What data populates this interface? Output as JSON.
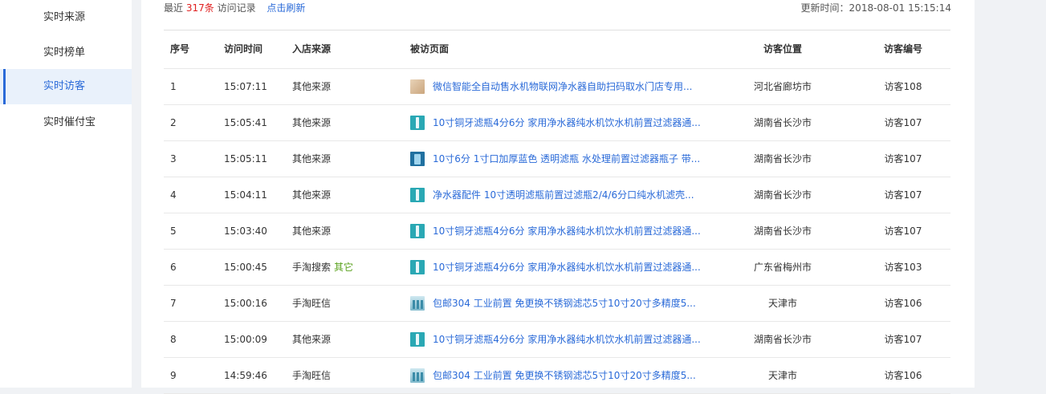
{
  "sidebar": {
    "items": [
      {
        "label": "实时来源",
        "active": false
      },
      {
        "label": "实时榜单",
        "active": false
      },
      {
        "label": "实时访客",
        "active": true
      },
      {
        "label": "实时催付宝",
        "active": false
      }
    ]
  },
  "summary": {
    "prefix": "最近",
    "count": "317条",
    "suffix": "访问记录",
    "refresh_label": "点击刷新",
    "updated_label": "更新时间：2018-08-01 15:15:14"
  },
  "table": {
    "headers": {
      "idx": "序号",
      "time": "访问时间",
      "source": "入店来源",
      "page": "被访页面",
      "location": "访客位置",
      "visitor": "访客编号"
    },
    "rows": [
      {
        "idx": "1",
        "time": "15:07:11",
        "source": "其他来源",
        "source_tag": "",
        "thumb": "product-thumb-tan",
        "page": "微信智能全自动售水机物联网净水器自助扫码取水门店专用...",
        "location": "河北省廊坊市",
        "visitor": "访客108"
      },
      {
        "idx": "2",
        "time": "15:05:41",
        "source": "其他来源",
        "source_tag": "",
        "thumb": "product-thumb-teal",
        "page": "10寸铜牙滤瓶4分6分 家用净水器纯水机饮水机前置过滤器通...",
        "location": "湖南省长沙市",
        "visitor": "访客107"
      },
      {
        "idx": "3",
        "time": "15:05:11",
        "source": "其他来源",
        "source_tag": "",
        "thumb": "product-thumb-blue",
        "page": "10寸6分 1寸口加厚蓝色 透明滤瓶 水处理前置过滤器瓶子 带...",
        "location": "湖南省长沙市",
        "visitor": "访客107"
      },
      {
        "idx": "4",
        "time": "15:04:11",
        "source": "其他来源",
        "source_tag": "",
        "thumb": "product-thumb-teal",
        "page": "净水器配件 10寸透明滤瓶前置过滤瓶2/4/6分口纯水机滤壳...",
        "location": "湖南省长沙市",
        "visitor": "访客107"
      },
      {
        "idx": "5",
        "time": "15:03:40",
        "source": "其他来源",
        "source_tag": "",
        "thumb": "product-thumb-teal",
        "page": "10寸铜牙滤瓶4分6分 家用净水器纯水机饮水机前置过滤器通...",
        "location": "湖南省长沙市",
        "visitor": "访客107"
      },
      {
        "idx": "6",
        "time": "15:00:45",
        "source": "手淘搜索",
        "source_tag": "其它",
        "thumb": "product-thumb-teal",
        "page": "10寸铜牙滤瓶4分6分 家用净水器纯水机饮水机前置过滤器通...",
        "location": "广东省梅州市",
        "visitor": "访客103"
      },
      {
        "idx": "7",
        "time": "15:00:16",
        "source": "手淘旺信",
        "source_tag": "",
        "thumb": "product-thumb-filters",
        "page": "包邮304 工业前置 免更换不锈钢滤芯5寸10寸20寸多精度5...",
        "location": "天津市",
        "visitor": "访客106"
      },
      {
        "idx": "8",
        "time": "15:00:09",
        "source": "其他来源",
        "source_tag": "",
        "thumb": "product-thumb-teal",
        "page": "10寸铜牙滤瓶4分6分 家用净水器纯水机饮水机前置过滤器通...",
        "location": "湖南省长沙市",
        "visitor": "访客107"
      },
      {
        "idx": "9",
        "time": "14:59:46",
        "source": "手淘旺信",
        "source_tag": "",
        "thumb": "product-thumb-filters",
        "page": "包邮304 工业前置 免更换不锈钢滤芯5寸10寸20寸多精度5...",
        "location": "天津市",
        "visitor": "访客106"
      }
    ]
  },
  "colors": {
    "accent": "#2a6ad8",
    "count_red": "#e02020",
    "tag_green": "#5aa21e"
  }
}
